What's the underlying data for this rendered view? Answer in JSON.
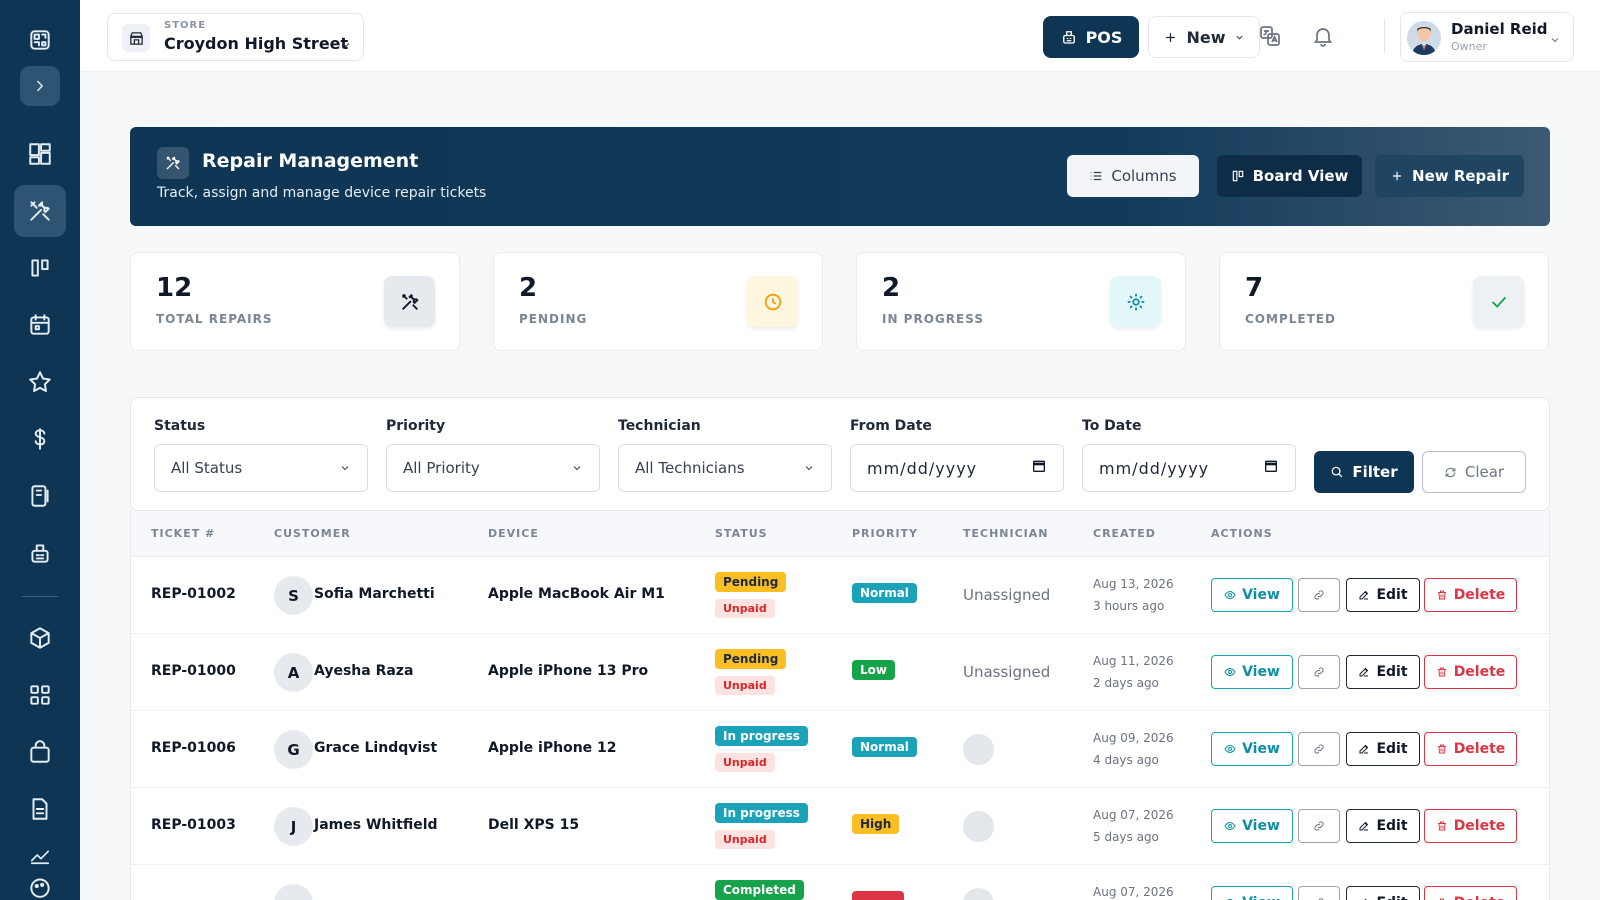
{
  "colors": {
    "sidebar": "#0f3554",
    "primary": "#0f3554",
    "pending_bg": "#fbbf24",
    "in_progress_bg": "#1aa2b8",
    "completed_bg": "#16a34a",
    "unpaid_bg": "#fde2e2",
    "unpaid_text": "#dc2626",
    "normal_bg": "#1aa2b8",
    "low_bg": "#16a34a",
    "high_bg": "#fbbf24",
    "danger": "#dc3545"
  },
  "sidebar": {
    "items": [
      {
        "icon": "qr-code-icon"
      },
      {
        "icon": "chevron-right-icon"
      },
      {
        "icon": "dashboard-icon"
      },
      {
        "icon": "tools-icon",
        "active": true
      },
      {
        "icon": "board-icon"
      },
      {
        "icon": "calendar-icon"
      },
      {
        "icon": "star-icon"
      },
      {
        "icon": "dollar-icon"
      },
      {
        "icon": "device-icon"
      },
      {
        "icon": "cash-register-icon"
      },
      {
        "icon": "box-icon"
      },
      {
        "icon": "grid-icon"
      },
      {
        "icon": "shopping-bag-icon"
      },
      {
        "icon": "document-icon"
      },
      {
        "icon": "chart-icon"
      },
      {
        "icon": "palette-icon"
      }
    ]
  },
  "header": {
    "store_label": "STORE",
    "store_name": "Croydon High Street",
    "pos_label": "POS",
    "new_label": "New",
    "user_name": "Daniel Reid",
    "user_role": "Owner"
  },
  "hero": {
    "title": "Repair Management",
    "subtitle": "Track, assign and manage device repair tickets",
    "columns_label": "Columns",
    "board_label": "Board View",
    "new_repair_label": "New Repair"
  },
  "stats": [
    {
      "value": "12",
      "label": "TOTAL REPAIRS",
      "icon": "tools-icon",
      "icon_bg": "#e6e9ee",
      "icon_color": "#111827"
    },
    {
      "value": "2",
      "label": "PENDING",
      "icon": "clock-icon",
      "icon_bg": "#fff6e0",
      "icon_color": "#f59e0b"
    },
    {
      "value": "2",
      "label": "IN PROGRESS",
      "icon": "gear-icon",
      "icon_bg": "#e3f6f9",
      "icon_color": "#0e8fa3"
    },
    {
      "value": "7",
      "label": "COMPLETED",
      "icon": "check-icon",
      "icon_bg": "#edf1f3",
      "icon_color": "#16a34a"
    }
  ],
  "filters": {
    "status_label": "Status",
    "status_value": "All Status",
    "priority_label": "Priority",
    "priority_value": "All Priority",
    "technician_label": "Technician",
    "technician_value": "All Technicians",
    "from_label": "From Date",
    "from_value": "mm/dd/yyyy",
    "to_label": "To Date",
    "to_value": "mm/dd/yyyy",
    "filter_label": "Filter",
    "clear_label": "Clear"
  },
  "table": {
    "headers": [
      "TICKET #",
      "CUSTOMER",
      "DEVICE",
      "STATUS",
      "PRIORITY",
      "TECHNICIAN",
      "CREATED",
      "ACTIONS"
    ],
    "actions": {
      "view": "View",
      "edit": "Edit",
      "delete": "Delete"
    },
    "rows": [
      {
        "ticket": "REP-01002",
        "initial": "S",
        "customer": "Sofia Marchetti",
        "device": "Apple MacBook Air M1",
        "status": "Pending",
        "status_kind": "pending",
        "payment": "Unpaid",
        "priority": "Normal",
        "priority_kind": "normal",
        "technician": "Unassigned",
        "created": "Aug 13, 2026",
        "ago": "3 hours ago"
      },
      {
        "ticket": "REP-01000",
        "initial": "A",
        "customer": "Ayesha Raza",
        "device": "Apple iPhone 13 Pro",
        "status": "Pending",
        "status_kind": "pending",
        "payment": "Unpaid",
        "priority": "Low",
        "priority_kind": "low",
        "technician": "Unassigned",
        "created": "Aug 11, 2026",
        "ago": "2 days ago"
      },
      {
        "ticket": "REP-01006",
        "initial": "G",
        "customer": "Grace Lindqvist",
        "device": "Apple iPhone 12",
        "status": "In progress",
        "status_kind": "progress",
        "payment": "Unpaid",
        "priority": "Normal",
        "priority_kind": "normal",
        "technician": "",
        "created": "Aug 09, 2026",
        "ago": "4 days ago"
      },
      {
        "ticket": "REP-01003",
        "initial": "J",
        "customer": "James Whitfield",
        "device": "Dell XPS 15",
        "status": "In progress",
        "status_kind": "progress",
        "payment": "Unpaid",
        "priority": "High",
        "priority_kind": "high",
        "technician": "",
        "created": "Aug 07, 2026",
        "ago": "5 days ago"
      },
      {
        "ticket": "",
        "initial": "",
        "customer": "",
        "device": "",
        "status": "Completed",
        "status_kind": "completed",
        "payment": "",
        "priority": "",
        "priority_kind": "urgent",
        "technician": "",
        "created": "Aug 07, 2026",
        "ago": ""
      }
    ]
  }
}
